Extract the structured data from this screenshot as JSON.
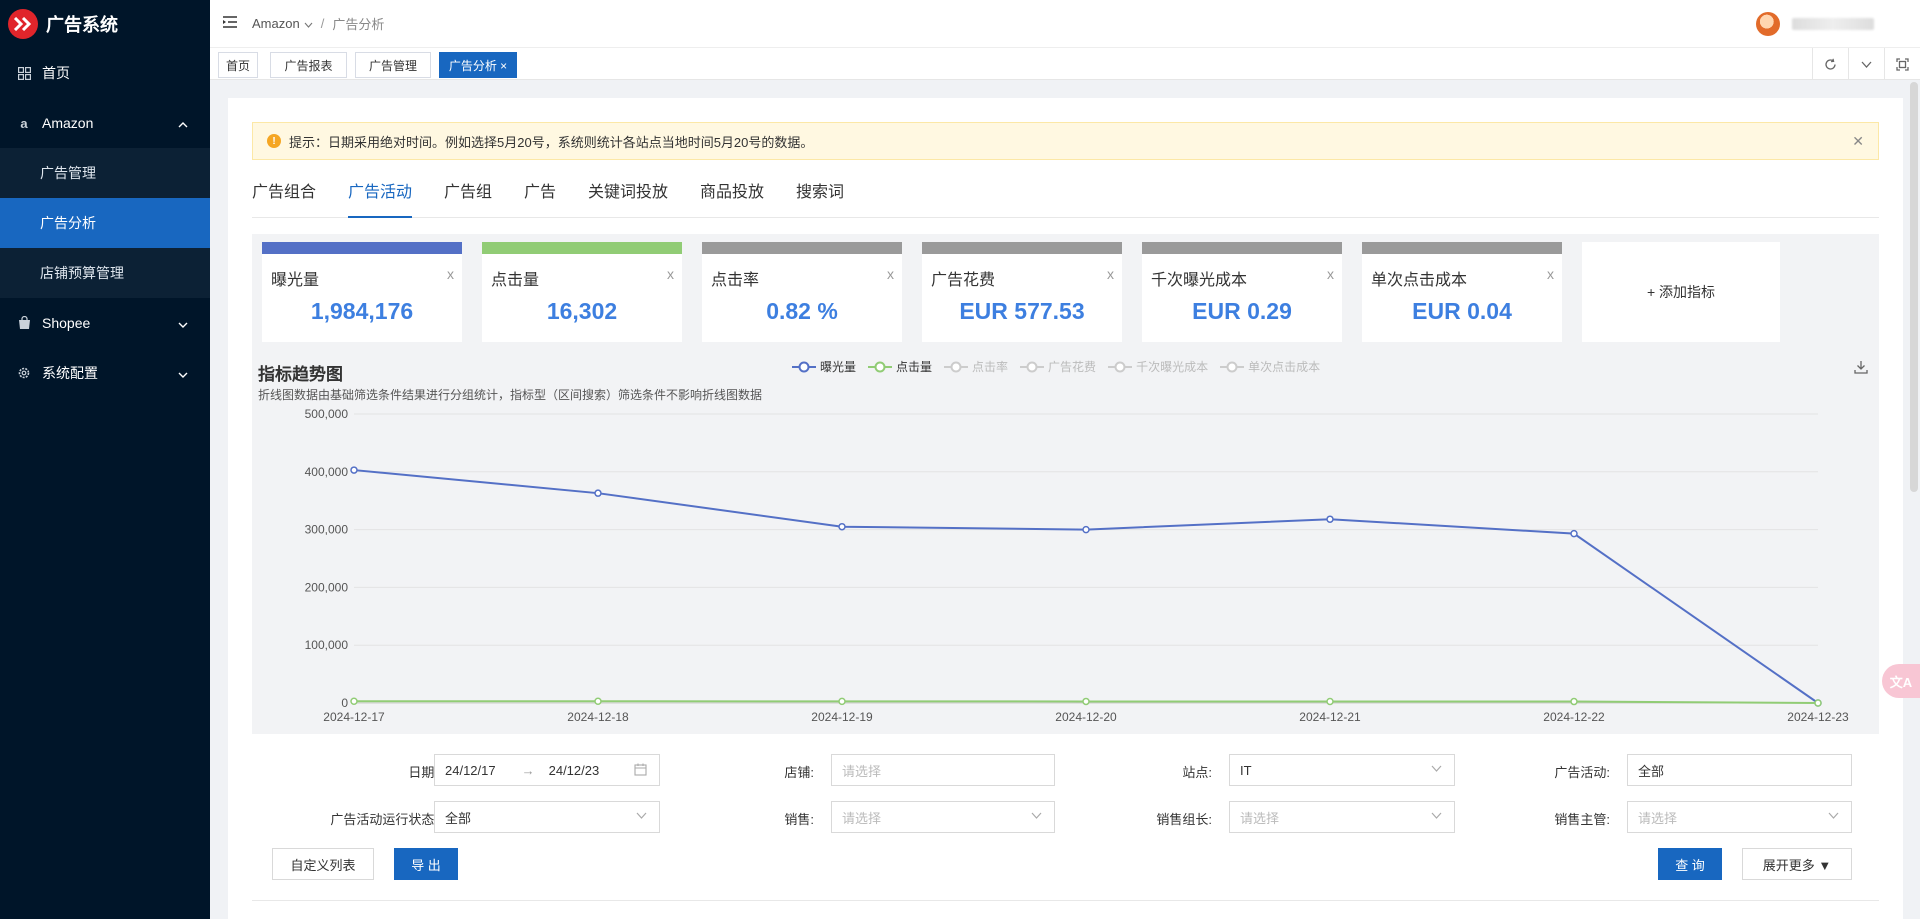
{
  "app": {
    "title": "广告系统"
  },
  "sidebar": {
    "items": [
      {
        "label": "首页",
        "icon": "dashboard-icon"
      },
      {
        "label": "Amazon",
        "icon": "amazon-icon",
        "expanded": true,
        "children": [
          {
            "label": "广告管理"
          },
          {
            "label": "广告分析",
            "active": true
          },
          {
            "label": "店铺预算管理"
          }
        ]
      },
      {
        "label": "Shopee",
        "icon": "bag-icon"
      },
      {
        "label": "系统配置",
        "icon": "gear-icon"
      }
    ]
  },
  "header": {
    "breadcrumb": [
      "Amazon",
      "广告分析"
    ]
  },
  "tags": [
    {
      "label": "首页"
    },
    {
      "label": "广告报表"
    },
    {
      "label": "广告管理"
    },
    {
      "label": "广告分析 ×",
      "active": true
    }
  ],
  "notice": {
    "text": "提示：日期采用绝对时间。例如选择5月20号，系统则统计各站点当地时间5月20号的数据。"
  },
  "tabs": [
    "广告组合",
    "广告活动",
    "广告组",
    "广告",
    "关键词投放",
    "商品投放",
    "搜索词"
  ],
  "active_tab": "广告活动",
  "metrics": [
    {
      "name": "曝光量",
      "value": "1,984,176",
      "color": "#5470c6",
      "close": "x"
    },
    {
      "name": "点击量",
      "value": "16,302",
      "color": "#91cc75",
      "close": "x"
    },
    {
      "name": "点击率",
      "value": "0.82 %",
      "color": "#9a9a9a",
      "close": "x"
    },
    {
      "name": "广告花费",
      "value": "EUR 577.53",
      "color": "#9a9a9a",
      "close": "x"
    },
    {
      "name": "千次曝光成本",
      "value": "EUR 0.29",
      "color": "#9a9a9a",
      "close": "x"
    },
    {
      "name": "单次点击成本",
      "value": "EUR 0.04",
      "color": "#9a9a9a",
      "close": "x"
    }
  ],
  "add_metric_label": "+ 添加指标",
  "chart": {
    "title": "指标趋势图",
    "subtitle": "折线图数据由基础筛选条件结果进行分组统计，指标型（区间搜索）筛选条件不影响折线图数据",
    "legend": [
      {
        "name": "曝光量",
        "color": "#5470c6",
        "active": true
      },
      {
        "name": "点击量",
        "color": "#91cc75",
        "active": true
      },
      {
        "name": "点击率",
        "color": "#cccccc",
        "active": false
      },
      {
        "name": "广告花费",
        "color": "#cccccc",
        "active": false
      },
      {
        "name": "千次曝光成本",
        "color": "#cccccc",
        "active": false
      },
      {
        "name": "单次点击成本",
        "color": "#cccccc",
        "active": false
      }
    ]
  },
  "chart_data": {
    "type": "line",
    "x": [
      "2024-12-17",
      "2024-12-18",
      "2024-12-19",
      "2024-12-20",
      "2024-12-21",
      "2024-12-22",
      "2024-12-23"
    ],
    "y_ticks": [
      "0",
      "100,000",
      "200,000",
      "300,000",
      "400,000",
      "500,000"
    ],
    "ylim": [
      0,
      500000
    ],
    "grid": true,
    "series": [
      {
        "name": "曝光量",
        "color": "#5470c6",
        "values": [
          403000,
          363000,
          305000,
          300000,
          318000,
          293000,
          0
        ]
      },
      {
        "name": "点击量",
        "color": "#91cc75",
        "values": [
          3000,
          3000,
          2800,
          2700,
          2600,
          2500,
          0
        ]
      }
    ]
  },
  "filters": {
    "date_label": "日期:",
    "date_start": "24/12/17",
    "date_arrow": "→",
    "date_end": "24/12/23",
    "shop_label": "店铺:",
    "shop_placeholder": "请选择",
    "site_label": "站点:",
    "site_value": "IT",
    "campaign_label": "广告活动:",
    "campaign_value": "全部",
    "status_label": "广告活动运行状态:",
    "status_value": "全部",
    "sales_label": "销售:",
    "sales_placeholder": "请选择",
    "leader_label": "销售组长:",
    "leader_placeholder": "请选择",
    "manager_label": "销售主管:",
    "manager_placeholder": "请选择"
  },
  "buttons": {
    "custom_columns": "自定义列表",
    "export": "导 出",
    "query": "查 询",
    "expand_more": "展开更多 ▼"
  },
  "float_button": {
    "label": "文A"
  }
}
